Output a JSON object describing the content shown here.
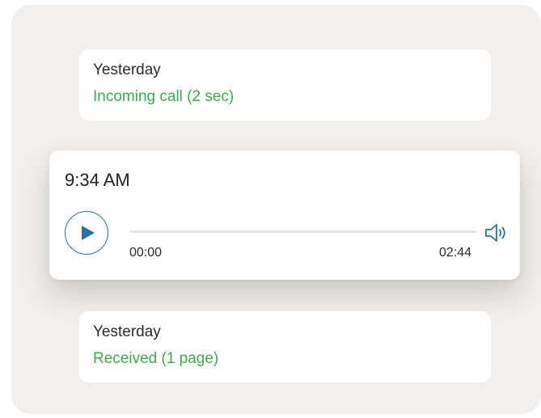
{
  "feed": {
    "top_card": {
      "title": "Yesterday",
      "status": "Incoming call (2 sec)"
    },
    "player": {
      "time": "9:34 AM",
      "elapsed": "00:00",
      "duration": "02:44",
      "progress_fraction": 0,
      "play_icon": "play-icon",
      "volume_icon": "speaker-icon"
    },
    "bottom_card": {
      "title": "Yesterday",
      "status": "Received (1 page)"
    }
  },
  "colors": {
    "status_green": "#3cab4a",
    "accent_blue": "#2a6fa8",
    "panel_bg": "#f1f0ee",
    "card_bg": "#ffffff"
  }
}
